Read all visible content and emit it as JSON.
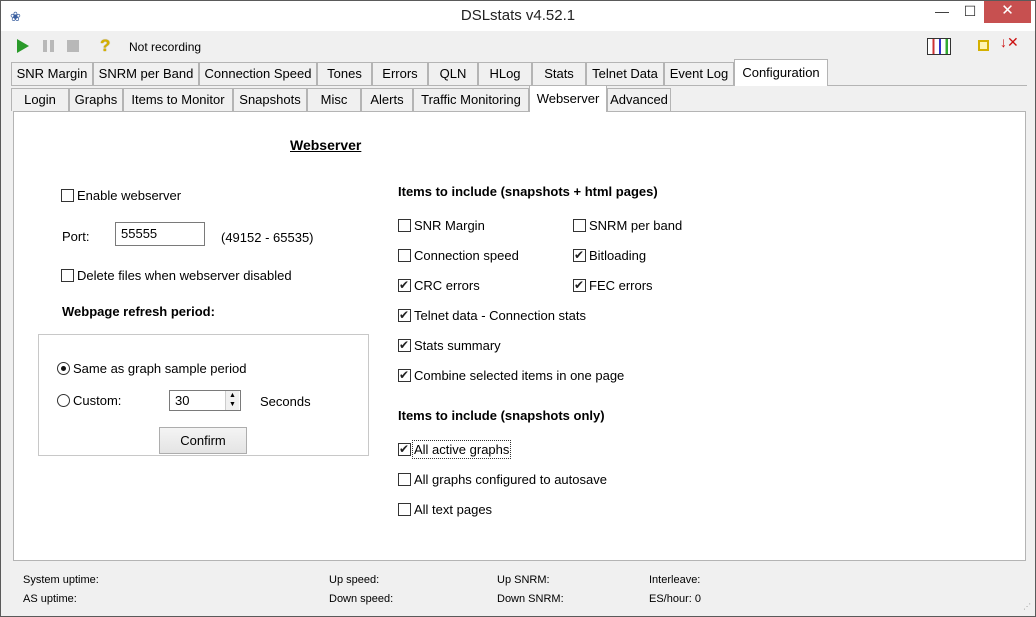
{
  "window": {
    "title": "DSLstats v4.52.1",
    "min_glyph": "—",
    "max_glyph": "☐",
    "close_glyph": "✕"
  },
  "toolbar": {
    "status": "Not recording",
    "help_glyph": "?",
    "exit_glyph": "↓✕"
  },
  "main_tabs": [
    "SNR Margin",
    "SNRM per Band",
    "Connection Speed",
    "Tones",
    "Errors",
    "QLN",
    "HLog",
    "Stats",
    "Telnet Data",
    "Event Log",
    "Configuration"
  ],
  "main_active_tab": "Configuration",
  "config_tabs": [
    "Login",
    "Graphs",
    "Items to Monitor",
    "Snapshots",
    "Misc",
    "Alerts",
    "Traffic Monitoring",
    "Webserver",
    "Advanced"
  ],
  "config_active_tab": "Webserver",
  "webserver": {
    "heading": "Webserver",
    "enable_label": "Enable webserver",
    "enable_checked": false,
    "port_label": "Port:",
    "port_value": "55555",
    "port_range": "(49152 - 65535)",
    "delete_label": "Delete files when webserver disabled",
    "delete_checked": false,
    "refresh_heading": "Webpage refresh period:",
    "same_as_graph_label": "Same as graph sample period",
    "same_as_graph_selected": true,
    "custom_label": "Custom:",
    "custom_selected": false,
    "custom_value": "30",
    "seconds_label": "Seconds",
    "confirm_label": "Confirm",
    "spin_up": "▲",
    "spin_down": "▼"
  },
  "include_html": {
    "heading": "Items to include (snapshots + html pages)",
    "items": [
      {
        "label": "SNR Margin",
        "checked": false
      },
      {
        "label": "SNRM per band",
        "checked": false
      },
      {
        "label": "Connection speed",
        "checked": false
      },
      {
        "label": "Bitloading",
        "checked": true
      },
      {
        "label": "CRC errors",
        "checked": true
      },
      {
        "label": "FEC errors",
        "checked": true
      },
      {
        "label": "Telnet data - Connection stats",
        "checked": true
      },
      {
        "label": "Stats summary",
        "checked": true
      },
      {
        "label": "Combine selected items in one page",
        "checked": true
      }
    ]
  },
  "include_snapshots": {
    "heading": "Items to include (snapshots only)",
    "items": [
      {
        "label": "All active graphs",
        "checked": true
      },
      {
        "label": "All graphs configured to autosave",
        "checked": false
      },
      {
        "label": "All text pages",
        "checked": false
      }
    ]
  },
  "status": {
    "system_uptime": "System uptime:",
    "as_uptime": "AS uptime:",
    "up_speed": "Up speed:",
    "down_speed": "Down speed:",
    "up_snrm": "Up SNRM:",
    "down_snrm": "Down SNRM:",
    "interleave": "Interleave:",
    "es_hour": "ES/hour: 0"
  }
}
